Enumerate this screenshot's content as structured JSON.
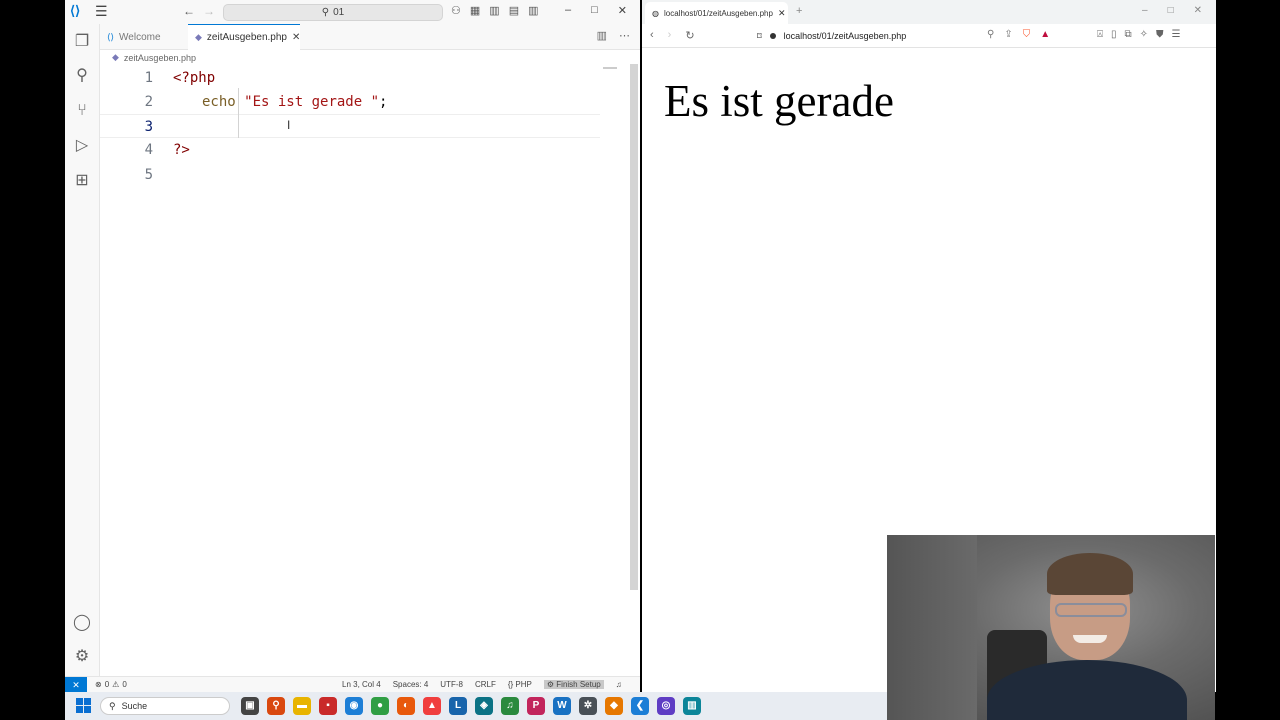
{
  "vscode": {
    "search_text": "01",
    "tabs": [
      {
        "label": "Welcome",
        "active": false
      },
      {
        "label": "zeitAusgeben.php",
        "active": true
      }
    ],
    "breadcrumb": "zeitAusgeben.php",
    "code_lines": [
      {
        "number": "1",
        "text": "<?php"
      },
      {
        "number": "2",
        "text_echo": "echo",
        "text_string": "\"Es ist gerade \"",
        "text_end": ";"
      },
      {
        "number": "3",
        "text": ""
      },
      {
        "number": "4",
        "text": "?>"
      },
      {
        "number": "5",
        "text": ""
      }
    ],
    "status": {
      "errors": "0",
      "warnings": "0",
      "position": "Ln 3, Col 4",
      "spaces": "Spaces: 4",
      "encoding": "UTF-8",
      "eol": "CRLF",
      "language": "PHP",
      "finish_setup": "Finish Setup"
    }
  },
  "browser": {
    "tab_title": "localhost/01/zeitAusgeben.php",
    "url": "localhost/01/zeitAusgeben.php",
    "page_text": "Es ist gerade"
  },
  "taskbar": {
    "search_placeholder": "Suche",
    "apps": [
      {
        "icon": "taskview-icon",
        "color": "#444444",
        "glyph": "▣"
      },
      {
        "icon": "search-tool-icon",
        "color": "#d9480f",
        "glyph": "⚲"
      },
      {
        "icon": "folder-icon",
        "color": "#e8b400",
        "glyph": "▬"
      },
      {
        "icon": "app-red-icon",
        "color": "#c92a2a",
        "glyph": "▪"
      },
      {
        "icon": "edge-icon",
        "color": "#1c7ed6",
        "glyph": "◉"
      },
      {
        "icon": "chrome-icon",
        "color": "#2f9e44",
        "glyph": "●"
      },
      {
        "icon": "firefox-icon",
        "color": "#e8590c",
        "glyph": "◐"
      },
      {
        "icon": "brave-icon",
        "color": "#f03e3e",
        "glyph": "▲"
      },
      {
        "icon": "app-l-icon",
        "color": "#1864ab",
        "glyph": "L"
      },
      {
        "icon": "app-blue-icon",
        "color": "#0b7285",
        "glyph": "◈"
      },
      {
        "icon": "spotify-icon",
        "color": "#2b8a3e",
        "glyph": "♫"
      },
      {
        "icon": "pdf-icon",
        "color": "#c2255c",
        "glyph": "P"
      },
      {
        "icon": "word-icon",
        "color": "#1971c2",
        "glyph": "W"
      },
      {
        "icon": "network-icon",
        "color": "#495057",
        "glyph": "✲"
      },
      {
        "icon": "app-orange-icon",
        "color": "#e67700",
        "glyph": "◆"
      },
      {
        "icon": "vscode-icon",
        "color": "#1c7ed6",
        "glyph": "❮"
      },
      {
        "icon": "obs-icon",
        "color": "#5f3dc4",
        "glyph": "◎"
      },
      {
        "icon": "app-teal-icon",
        "color": "#0c8599",
        "glyph": "▥"
      }
    ]
  }
}
